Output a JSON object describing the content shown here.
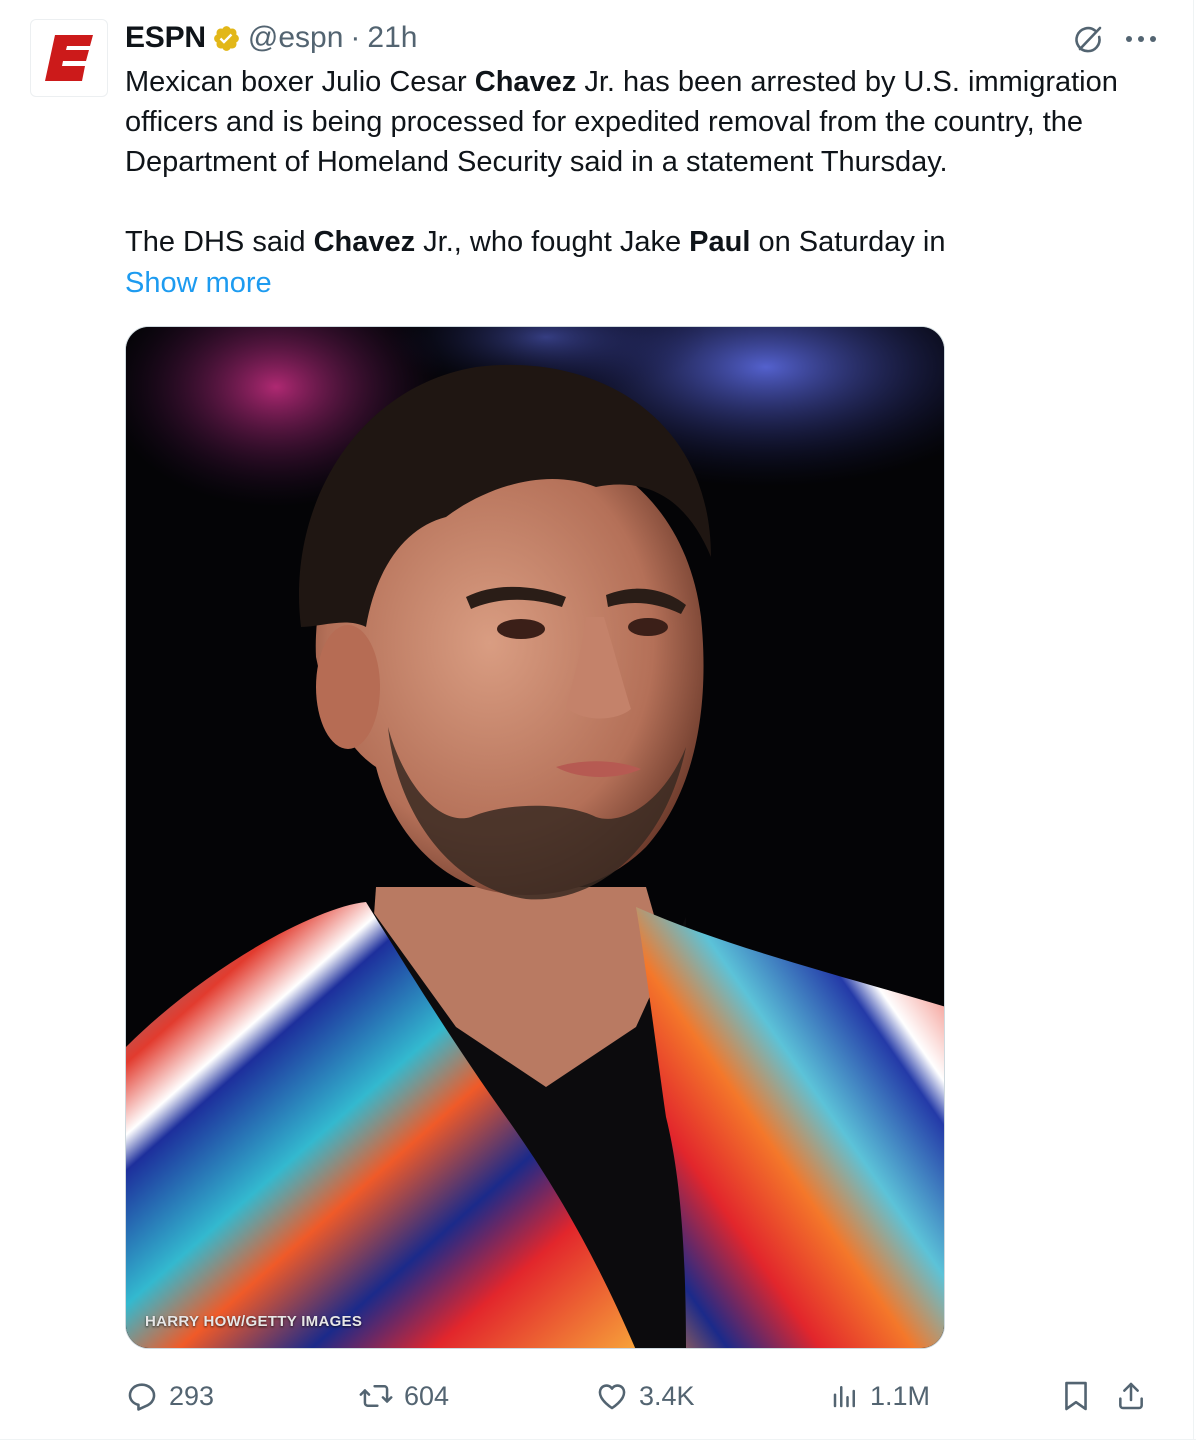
{
  "tweet": {
    "author_name": "ESPN",
    "handle": "@espn",
    "separator": "·",
    "time": "21h",
    "verified_icon": "verified-badge-icon",
    "verified_color": "#e2b719",
    "avatar_color": "#cc1a1a",
    "text": {
      "p1_a": "Mexican boxer Julio Cesar ",
      "p1_b": "Chavez",
      "p1_c": " Jr. has been arrested by U.S. immigration officers and is being processed for expedited removal from the country, the Department of Homeland Security said in a statement Thursday.",
      "p2_a": "The DHS said ",
      "p2_b": "Chavez",
      "p2_c": " Jr., who fought Jake ",
      "p2_d": "Paul",
      "p2_e": " on Saturday in"
    },
    "show_more": "Show more",
    "link_color": "#1d9bf0",
    "media": {
      "credit": "HARRY HOW/GETTY IMAGES"
    }
  },
  "actions": {
    "replies": "293",
    "reposts": "604",
    "likes": "3.4K",
    "views": "1.1M"
  }
}
